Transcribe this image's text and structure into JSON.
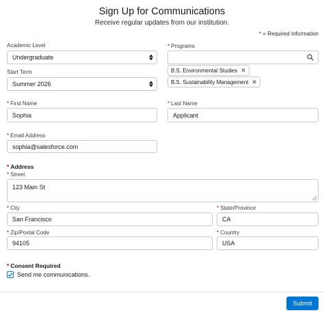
{
  "header": {
    "title": "Sign Up for Communications",
    "subtitle": "Receive regular updates from our institution."
  },
  "required_legend": {
    "star": "*",
    "text": " = Required Information"
  },
  "academic_level": {
    "label": "Academic Level",
    "value": "Undergraduate"
  },
  "start_term": {
    "label": "Start Term",
    "value": "Summer 2026"
  },
  "programs": {
    "label": "Programs",
    "search_value": "",
    "selected": [
      "B.S. Environmental Studies",
      "B.S. Sustainability Management"
    ]
  },
  "first_name": {
    "label": "First Name",
    "value": "Sophia"
  },
  "last_name": {
    "label": "Last Name",
    "value": "Applicant"
  },
  "email": {
    "label": "Email Address",
    "value": "sophia@salesforce.com"
  },
  "address": {
    "section_label": "Address",
    "street": {
      "label": "Street",
      "value": "123 Main St"
    },
    "city": {
      "label": "City",
      "value": "San Francisco"
    },
    "state": {
      "label": "State/Province",
      "value": "CA"
    },
    "zip": {
      "label": "Zip/Postal Code",
      "value": "94105"
    },
    "country": {
      "label": "Country",
      "value": "USA"
    }
  },
  "consent": {
    "section_label": "Consent Required",
    "checkbox_label": "Send me communications.",
    "checked": true
  },
  "submit_label": "Submit",
  "colors": {
    "brand": "#0176d3",
    "required": "#ba0517",
    "border": "#c9c9c9"
  },
  "icons": {
    "search": "search-icon",
    "remove": "close-icon",
    "select": "up-down-chevron-icon",
    "check": "check-icon"
  }
}
